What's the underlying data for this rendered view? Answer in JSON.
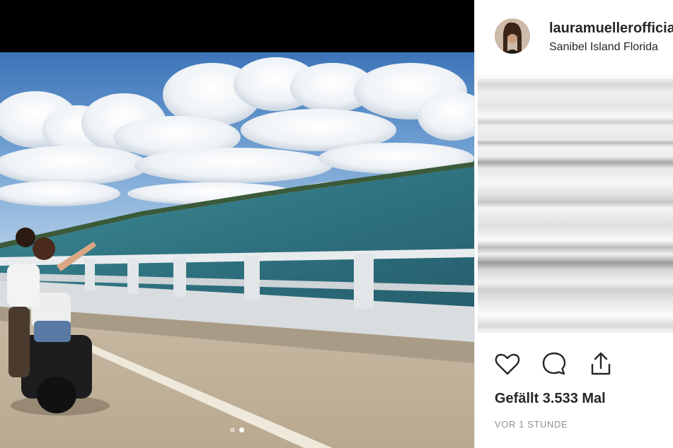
{
  "post": {
    "username": "lauramuellerofficial",
    "location": "Sanibel Island Florida",
    "likes_text": "Gefällt 3.533 Mal",
    "timestamp": "VOR 1 STUNDE"
  },
  "carousel": {
    "slides_count": 2,
    "active_slide": 2
  },
  "icons": {
    "like": "heart-icon",
    "comment": "comment-bubble-icon",
    "share": "share-upload-icon"
  }
}
